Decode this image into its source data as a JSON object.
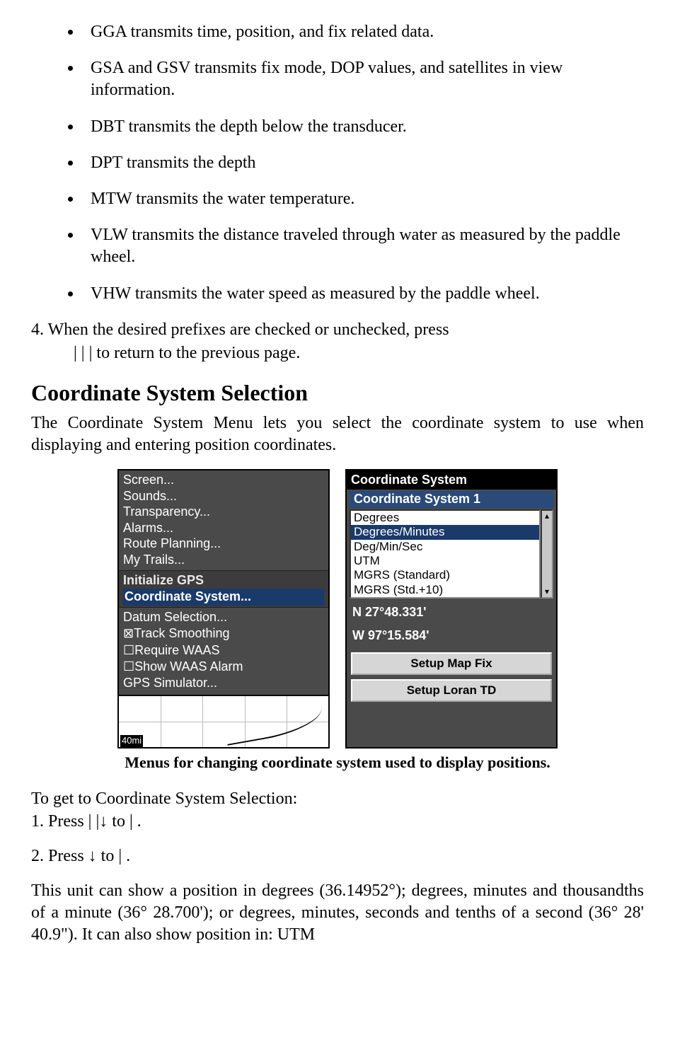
{
  "bullets": [
    "GGA transmits time, position, and fix related data.",
    "GSA and GSV transmits fix mode, DOP values, and satellites in view information.",
    "DBT transmits the depth below the transducer.",
    "DPT transmits the depth",
    "MTW transmits the water temperature.",
    "VLW transmits the distance traveled through water as measured by the paddle wheel.",
    "VHW transmits the water speed as measured by the paddle wheel."
  ],
  "step4_line1": "4. When the desired prefixes are checked or unchecked, press",
  "step4_line2": "|      |      |        to return to the previous page.",
  "section_heading": "Coordinate System Selection",
  "section_body": "The Coordinate System Menu lets you select the coordinate system to use when displaying and entering position coordinates.",
  "screenshot_a": {
    "top": [
      "Screen...",
      "Sounds...",
      "Transparency...",
      "Alarms...",
      "Route Planning...",
      "My Trails..."
    ],
    "mid_init": "Initialize GPS",
    "mid_hilite": "Coordinate System...",
    "bot_first": "Datum Selection...",
    "bot_checks": [
      {
        "checked": true,
        "label": "Track Smoothing"
      },
      {
        "checked": false,
        "label": "Require WAAS"
      },
      {
        "checked": false,
        "label": "Show WAAS Alarm"
      }
    ],
    "bot_last": "GPS Simulator...",
    "map_scale": "40mi"
  },
  "screenshot_b": {
    "title": "Coordinate System",
    "subtitle": "Coordinate System 1",
    "list": [
      "Degrees",
      "Degrees/Minutes",
      "Deg/Min/Sec",
      "UTM",
      "MGRS (Standard)",
      "MGRS (Std.+10)"
    ],
    "selected_index": 1,
    "coord_n": "N   27°48.331'",
    "coord_w": "W   97°15.584'",
    "btn1": "Setup Map Fix",
    "btn2": "Setup Loran TD"
  },
  "caption": "Menus for changing coordinate system used to display positions.",
  "steps_intro": "To get to Coordinate System Selection:",
  "steps_1": "1. Press          |          |↓ to                    |      .",
  "steps_2": "2. Press ↓ to                                |      .",
  "final_para": "This unit can show a position in degrees (36.14952°); degrees, minutes and thousandths of a minute (36° 28.700'); or degrees, minutes, seconds and tenths of a second (36° 28' 40.9\"). It can also show position in: UTM"
}
